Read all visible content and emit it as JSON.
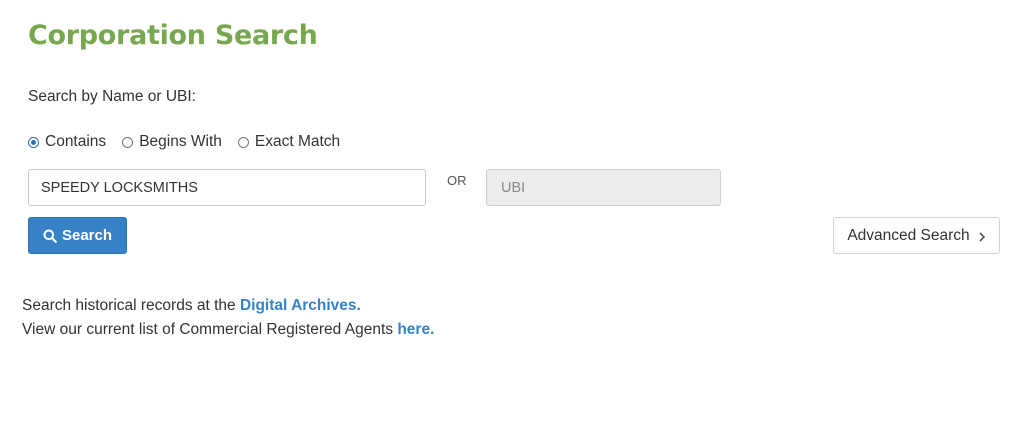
{
  "page": {
    "title": "Corporation Search",
    "search_label": "Search by Name or UBI:"
  },
  "match_options": [
    {
      "label": "Contains",
      "selected": true
    },
    {
      "label": "Begins With",
      "selected": false
    },
    {
      "label": "Exact Match",
      "selected": false
    }
  ],
  "name_field": {
    "value": "SPEEDY LOCKSMITHS"
  },
  "or_label": "OR",
  "ubi_field": {
    "value": "",
    "placeholder": "UBI"
  },
  "buttons": {
    "search_label": "Search",
    "advanced_label": "Advanced Search"
  },
  "info": {
    "archives_prefix": "Search historical records at the ",
    "archives_link": "Digital Archives.",
    "agents_prefix": "View our current list of Commercial Registered Agents ",
    "agents_link": "here."
  },
  "colors": {
    "title_green": "#77a84f",
    "accent_blue": "#3782c7",
    "disabled_gray": "#ececec"
  },
  "icons": {
    "search_button": "search-icon",
    "advanced_button": "chevron-right-icon"
  }
}
